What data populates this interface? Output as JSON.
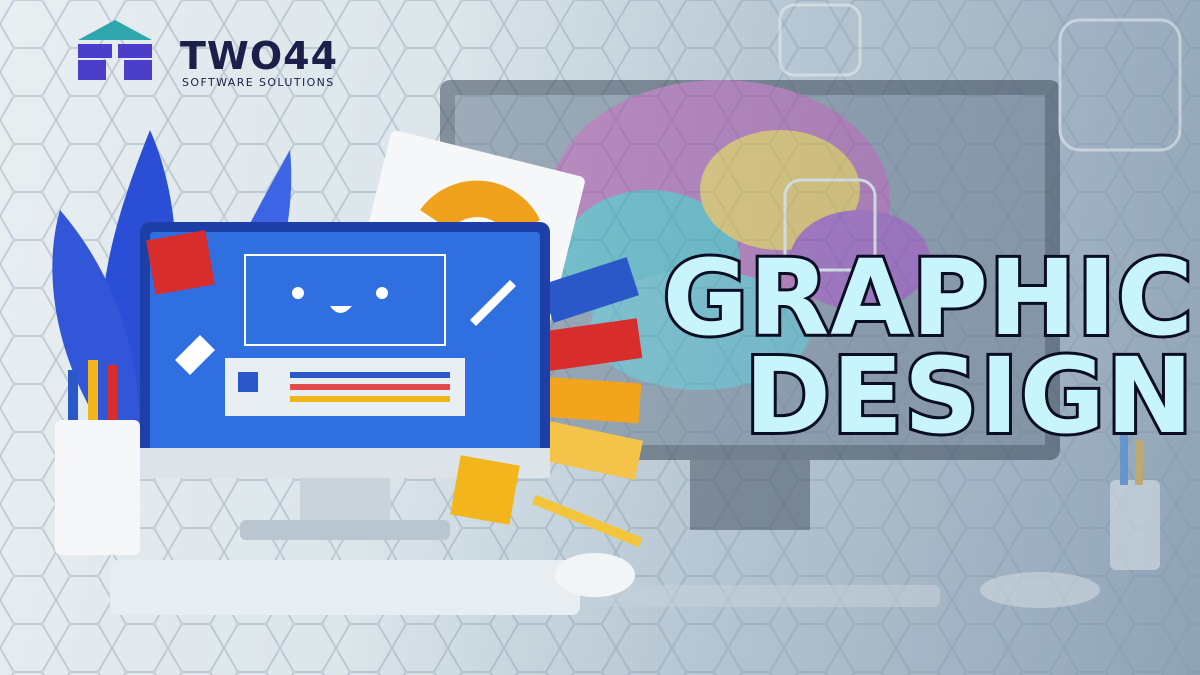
{
  "brand": {
    "name": "TWO44",
    "tagline": "SOFTWARE SOLUTIONS",
    "logo_colors": [
      "#2fa7ad",
      "#4b3ec9"
    ]
  },
  "headline": {
    "line1": "GRAPHIC",
    "line2": "DESIGN",
    "fill_color": "#c8f4fb",
    "outline_color": "#0b0d22"
  },
  "monitor": {
    "screen_color": "#2f6fe0"
  }
}
